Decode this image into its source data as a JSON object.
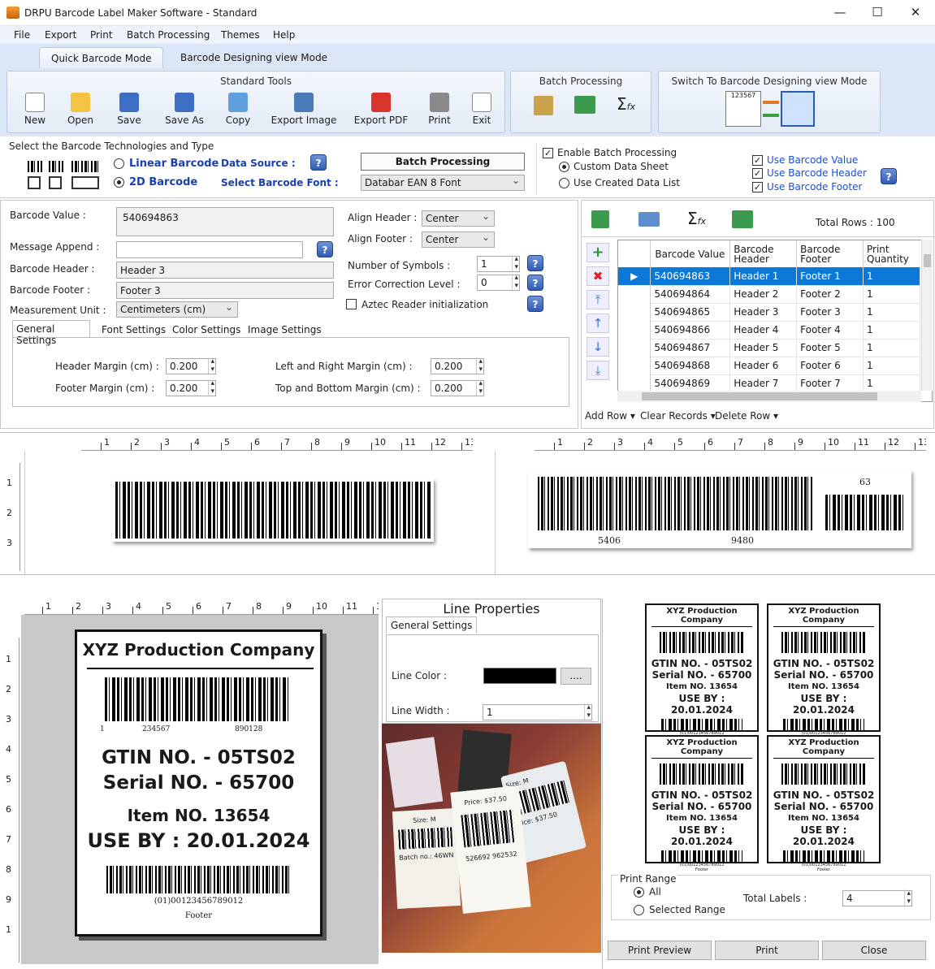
{
  "window": {
    "title": "DRPU Barcode Label Maker Software - Standard",
    "minimize": "—",
    "maximize": "☐",
    "close": "✕"
  },
  "menu": [
    "File",
    "Export",
    "Print",
    "Batch Processing",
    "Themes",
    "Help"
  ],
  "modes": {
    "quick": "Quick Barcode Mode",
    "designing": "Barcode Designing view Mode"
  },
  "ribbon": {
    "standard_title": "Standard Tools",
    "tools": [
      "New",
      "Open",
      "Save",
      "Save As",
      "Copy",
      "Export Image",
      "Export PDF",
      "Print",
      "Exit"
    ],
    "batch_title": "Batch Processing",
    "switch_title": "Switch To Barcode Designing view Mode",
    "switch_sample": "123567"
  },
  "tech": {
    "title": "Select the Barcode Technologies and Type",
    "linear": "Linear Barcode",
    "twod": "2D Barcode",
    "selected": "2D Barcode",
    "data_source": "Data Source :",
    "select_font": "Select Barcode Font :",
    "batch_button": "Batch Processing",
    "font_value": "Databar EAN 8 Font"
  },
  "batch_opts": {
    "enable": "Enable Batch Processing",
    "custom": "Custom Data Sheet",
    "created": "Use Created Data List",
    "use_value": "Use Barcode Value",
    "use_header": "Use Barcode Header",
    "use_footer": "Use Barcode Footer"
  },
  "form": {
    "barcode_value_label": "Barcode Value :",
    "barcode_value": "540694863",
    "message_label": "Message Append :",
    "message_value": "",
    "header_label": "Barcode Header :",
    "header_value": "Header 3",
    "footer_label": "Barcode Footer :",
    "footer_value": "Footer 3",
    "unit_label": "Measurement Unit :",
    "unit_value": "Centimeters (cm)",
    "align_header_label": "Align Header :",
    "align_header": "Center",
    "align_footer_label": "Align Footer :",
    "align_footer": "Center",
    "symbols_label": "Number of Symbols :",
    "symbols": "1",
    "error_label": "Error Correction Level :",
    "error": "0",
    "aztec": "Aztec Reader initialization"
  },
  "subtabs": [
    "General Settings",
    "Font Settings",
    "Color Settings",
    "Image Settings"
  ],
  "margins": {
    "header_label": "Header Margin (cm) :",
    "header": "0.200",
    "footer_label": "Footer Margin (cm) :",
    "footer": "0.200",
    "lr_label": "Left  and Right Margin (cm) :",
    "lr": "0.200",
    "tb_label": "Top and Bottom Margin (cm) :",
    "tb": "0.200"
  },
  "grid": {
    "total_rows": "Total Rows : 100",
    "headers": [
      "Barcode Value",
      "Barcode Header",
      "Barcode Footer",
      "Print Quantity"
    ],
    "rows": [
      [
        "540694863",
        "Header 1",
        "Footer 1",
        "1"
      ],
      [
        "540694864",
        "Header 2",
        "Footer 2",
        "1"
      ],
      [
        "540694865",
        "Header 3",
        "Footer 3",
        "1"
      ],
      [
        "540694866",
        "Header 4",
        "Footer 4",
        "1"
      ],
      [
        "540694867",
        "Header 5",
        "Footer 5",
        "1"
      ],
      [
        "540694868",
        "Header 6",
        "Footer 6",
        "1"
      ],
      [
        "540694869",
        "Header 7",
        "Footer 7",
        "1"
      ]
    ],
    "add_row": "Add Row",
    "clear": "Clear Records",
    "delete": "Delete Row"
  },
  "ruler_nums": [
    "1",
    "2",
    "3",
    "4",
    "5",
    "6",
    "7",
    "8",
    "9",
    "10",
    "11",
    "12",
    "13"
  ],
  "vruler_nums": [
    "1",
    "2",
    "3"
  ],
  "preview": {
    "num_left": "5406",
    "num_right": "9480",
    "num_top": "63"
  },
  "label": {
    "company": "XYZ Production Company",
    "bc_left": "1",
    "bc_mid": "234567",
    "bc_right": "890128",
    "gtin": "GTIN NO. - 05TS02",
    "serial": "Serial NO. - 65700",
    "item": "Item NO. 13654",
    "useby": "USE BY : 20.01.2024",
    "bottom_code": "(01)00123456789012",
    "footer": "Footer"
  },
  "label_ruler": [
    "1",
    "2",
    "3",
    "4",
    "5",
    "6",
    "7",
    "8",
    "9",
    "10",
    "11",
    "1"
  ],
  "label_vruler": [
    "1",
    "2",
    "3",
    "4",
    "5",
    "6",
    "7",
    "8",
    "9",
    "1"
  ],
  "line_props": {
    "title": "Line Properties",
    "tab": "General Settings",
    "color_label": "Line Color :",
    "browse": "....",
    "width_label": "Line Width :",
    "width": "1"
  },
  "print": {
    "card_company": "XYZ Production Company",
    "card_gtin": "GTIN NO. - 05TS02",
    "card_serial": "Serial NO. - 65700",
    "card_item": "Item NO. 13654",
    "card_useby": "USE BY : 20.01.2024",
    "card_code": "(01)00123456789012",
    "card_footer": "Footer",
    "range_title": "Print Range",
    "all": "All",
    "selected": "Selected Range",
    "total_label": "Total Labels :",
    "total": "4",
    "preview_btn": "Print Preview",
    "print_btn": "Print",
    "close_btn": "Close"
  },
  "photo_tags": [
    "Size: M",
    "Price: $37.50",
    "Batch no.: 46WN",
    "526692 962532"
  ]
}
